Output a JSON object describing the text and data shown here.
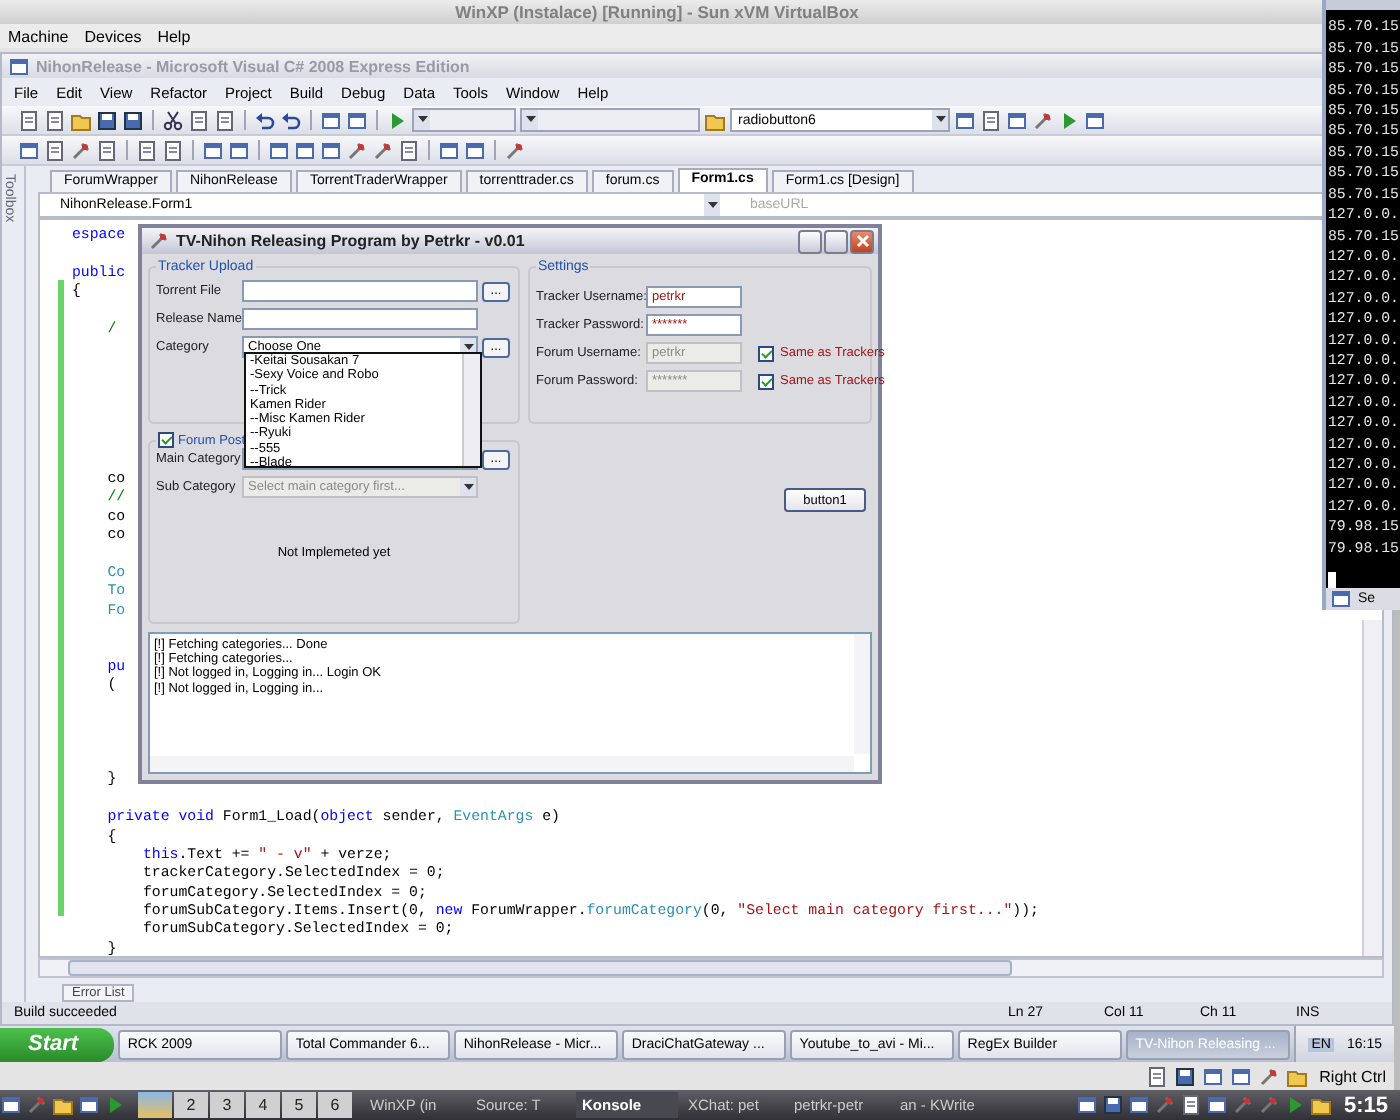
{
  "vbox": {
    "title": "WinXP (Instalace) [Running] - Sun xVM VirtualBox",
    "menu": [
      "Machine",
      "Devices",
      "Help"
    ],
    "host_key": "Right Ctrl"
  },
  "vs": {
    "title": "NihonRelease - Microsoft Visual C# 2008 Express Edition",
    "menu": [
      "File",
      "Edit",
      "View",
      "Refactor",
      "Project",
      "Build",
      "Debug",
      "Data",
      "Tools",
      "Window",
      "Help"
    ],
    "toolbar_combo": "radiobutton6",
    "toolbox_label": "Toolbox",
    "tabs": [
      {
        "label": "ForumWrapper",
        "selected": false
      },
      {
        "label": "NihonRelease",
        "selected": false
      },
      {
        "label": "TorrentTraderWrapper",
        "selected": false
      },
      {
        "label": "torrenttrader.cs",
        "selected": false
      },
      {
        "label": "forum.cs",
        "selected": false
      },
      {
        "label": "Form1.cs",
        "selected": true
      },
      {
        "label": "Form1.cs [Design]",
        "selected": false
      }
    ],
    "nav_class": "NihonRelease.Form1",
    "nav_member": "baseURL",
    "code": [
      [
        {
          "kind": "keyword",
          "text": "espace"
        }
      ],
      [
        {
          "kind": "keyword",
          "text": "public"
        }
      ],
      [
        {
          "kind": "plain",
          "text": "{"
        }
      ],
      [
        {
          "kind": "comment",
          "text": "    /"
        }
      ],
      [
        {
          "kind": "plain",
          "text": "    co"
        }
      ],
      [
        {
          "kind": "comment",
          "text": "    //"
        }
      ],
      [
        {
          "kind": "plain",
          "text": "    co"
        }
      ],
      [
        {
          "kind": "plain",
          "text": "    co"
        }
      ],
      [
        {
          "kind": "type",
          "text": "    Co"
        }
      ],
      [
        {
          "kind": "type",
          "text": "    To"
        }
      ],
      [
        {
          "kind": "type",
          "text": "    Fo"
        }
      ],
      [
        {
          "kind": "keyword",
          "text": "    pu"
        }
      ],
      [
        {
          "kind": "plain",
          "text": "    ("
        }
      ],
      [
        {
          "kind": "plain",
          "text": "    }"
        }
      ],
      [
        {
          "kind": "keyword",
          "text": "    private void "
        },
        {
          "kind": "plain",
          "text": "Form1_Load("
        },
        {
          "kind": "keyword",
          "text": "object"
        },
        {
          "kind": "plain",
          "text": " sender, "
        },
        {
          "kind": "type",
          "text": "EventArgs"
        },
        {
          "kind": "plain",
          "text": " e)"
        }
      ],
      [
        {
          "kind": "plain",
          "text": "    {"
        }
      ],
      [
        {
          "kind": "keyword",
          "text": "        this"
        },
        {
          "kind": "plain",
          "text": ".Text += "
        },
        {
          "kind": "string",
          "text": "\" - v\""
        },
        {
          "kind": "plain",
          "text": " + verze;"
        }
      ],
      [
        {
          "kind": "plain",
          "text": "        trackerCategory.SelectedIndex = 0;"
        }
      ],
      [
        {
          "kind": "plain",
          "text": "        forumCategory.SelectedIndex = 0;"
        }
      ],
      [
        {
          "kind": "plain",
          "text": "        forumSubCategory.Items.Insert(0, "
        },
        {
          "kind": "keyword",
          "text": "new"
        },
        {
          "kind": "plain",
          "text": " ForumWrapper."
        },
        {
          "kind": "type",
          "text": "forumCategory"
        },
        {
          "kind": "plain",
          "text": "(0, "
        },
        {
          "kind": "string",
          "text": "\"Select main category first...\""
        },
        {
          "kind": "plain",
          "text": "));"
        }
      ],
      [
        {
          "kind": "plain",
          "text": "        forumSubCategory.SelectedIndex = 0;"
        }
      ],
      [
        {
          "kind": "plain",
          "text": "    }"
        }
      ]
    ],
    "error_list_tab": "Error List",
    "status": {
      "message": "Build succeeded",
      "line": "Ln 27",
      "col": "Col 11",
      "ch": "Ch 11",
      "mode": "INS"
    }
  },
  "dialog": {
    "title": "TV-Nihon Releasing Program by Petrkr - v0.01",
    "tracker_upload": {
      "title": "Tracker Upload",
      "fields": [
        {
          "label": "Torrent File",
          "kind": "text_browse",
          "browse": "..."
        },
        {
          "label": "Release Name",
          "kind": "text"
        },
        {
          "label": "Category",
          "kind": "combo_browse",
          "value": "Choose One",
          "browse": "..."
        }
      ]
    },
    "category_dropdown": [
      "-Keitai Sousakan 7",
      "-Sexy Voice and Robo",
      "--Trick",
      "Kamen Rider",
      "--Misc Kamen Rider",
      "--Ryuki",
      "--555",
      "--Blade"
    ],
    "settings": {
      "title": "Settings",
      "fields": [
        {
          "label": "Tracker Username:",
          "value": "petrkr",
          "disabled": false
        },
        {
          "label": "Tracker Password:",
          "value": "*******",
          "disabled": false
        },
        {
          "label": "Forum Username:",
          "value": "petrkr",
          "disabled": true,
          "checkbox": {
            "label": "Same as Trackers",
            "checked": true
          }
        },
        {
          "label": "Forum Password:",
          "value": "*******",
          "disabled": true,
          "checkbox": {
            "label": "Same as Trackers",
            "checked": true
          }
        }
      ]
    },
    "forum_post": {
      "title": "Forum Post",
      "checked": true,
      "fields": [
        {
          "label": "Main Category",
          "kind": "combo_browse",
          "browse": "..."
        },
        {
          "label": "Sub Category",
          "kind": "combo",
          "value": "Select main category first...",
          "disabled": true
        }
      ],
      "note": "Not Implemeted yet"
    },
    "button": "button1",
    "log": [
      "[!] Fetching categories... Done",
      "[!] Fetching categories...",
      "[!] Not logged in, Logging in... Login OK",
      "[!] Not logged in, Logging in..."
    ]
  },
  "xp_taskbar": {
    "start": "Start",
    "tasks": [
      {
        "label": "RCK 2009",
        "selected": false
      },
      {
        "label": "Total Commander 6...",
        "selected": false
      },
      {
        "label": "NihonRelease - Micr...",
        "selected": false
      },
      {
        "label": "DraciChatGateway ...",
        "selected": false
      },
      {
        "label": "Youtube_to_avi - Mi...",
        "selected": false
      },
      {
        "label": "RegEx Builder",
        "selected": false
      },
      {
        "label": "TV-Nihon Releasing ...",
        "selected": true
      }
    ],
    "language": "EN",
    "clock": "16:15"
  },
  "terminal": {
    "lines": [
      "85.70.15",
      "85.70.15",
      "85.70.15",
      "85.70.15",
      "85.70.15",
      "85.70.15",
      "85.70.15",
      "85.70.15",
      "85.70.15",
      "127.0.0.",
      "85.70.15",
      "127.0.0.",
      "127.0.0.",
      "127.0.0.",
      "127.0.0.",
      "127.0.0.",
      "127.0.0.",
      "127.0.0.",
      "127.0.0.",
      "127.0.0.",
      "127.0.0.",
      "127.0.0.",
      "127.0.0.",
      "127.0.0.",
      "79.98.15",
      "79.98.15"
    ],
    "tab": "Se"
  },
  "kde_panel": {
    "desktops": [
      {
        "selected": true
      },
      {
        "label": "2",
        "selected": false
      },
      {
        "label": "3",
        "selected": false
      },
      {
        "label": "4",
        "selected": false
      },
      {
        "label": "5",
        "selected": false
      },
      {
        "label": "6",
        "selected": false
      }
    ],
    "tasks": [
      {
        "label": "WinXP (in",
        "selected": false
      },
      {
        "label": "Source: T",
        "selected": false
      },
      {
        "label": "Konsole",
        "selected": true
      },
      {
        "label": "XChat: pet",
        "selected": false
      },
      {
        "label": "petrkr-petr",
        "selected": false
      },
      {
        "label": "an - KWrite",
        "selected": false
      }
    ],
    "clock": "5:15"
  }
}
